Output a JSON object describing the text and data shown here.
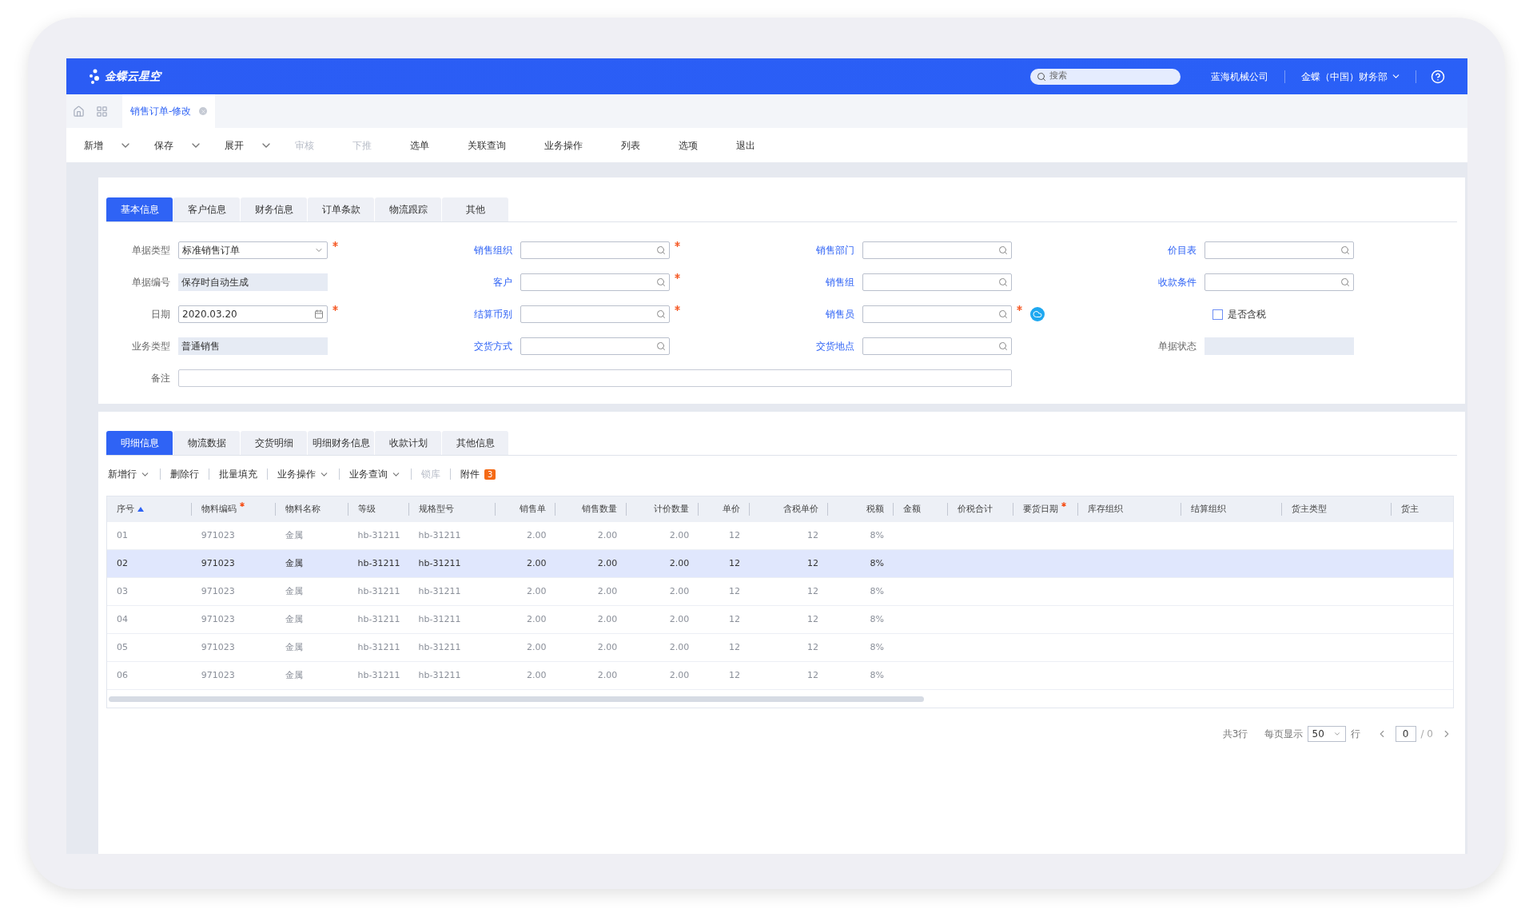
{
  "header": {
    "logo": "金蝶云星空",
    "search": {
      "placeholder": "搜索"
    },
    "company": "蓝海机械公司",
    "department": "金蝶（中国）财务部"
  },
  "page_tabs": [
    {
      "label": "销售订单-修改",
      "selected": true
    }
  ],
  "toolbar": [
    {
      "label": "新增",
      "kind": "split",
      "disabled": false
    },
    {
      "label": "保存",
      "kind": "split",
      "disabled": false
    },
    {
      "label": "展开",
      "kind": "split",
      "disabled": false
    },
    {
      "label": "审核",
      "kind": "plain",
      "disabled": true
    },
    {
      "label": "下推",
      "kind": "plain",
      "disabled": true
    },
    {
      "label": "选单",
      "kind": "plain",
      "disabled": false
    },
    {
      "label": "关联查询",
      "kind": "plain",
      "disabled": false
    },
    {
      "label": "业务操作",
      "kind": "plain",
      "disabled": false
    },
    {
      "label": "列表",
      "kind": "plain",
      "disabled": false
    },
    {
      "label": "选项",
      "kind": "plain",
      "disabled": false
    },
    {
      "label": "退出",
      "kind": "plain",
      "disabled": false
    }
  ],
  "form_tabs": [
    {
      "label": "基本信息",
      "selected": true
    },
    {
      "label": "客户信息",
      "selected": false
    },
    {
      "label": "财务信息",
      "selected": false
    },
    {
      "label": "订单条款",
      "selected": false
    },
    {
      "label": "物流跟踪",
      "selected": false
    },
    {
      "label": "其他",
      "selected": false
    }
  ],
  "form_fields": [
    {
      "label": "单据类型",
      "kind": "select",
      "value": "标准销售订单",
      "required": true,
      "link": false
    },
    {
      "label": "销售组织",
      "kind": "lookup",
      "required": true,
      "link": true
    },
    {
      "label": "销售部门",
      "kind": "lookup",
      "required": false,
      "link": true
    },
    {
      "label": "价目表",
      "kind": "lookup",
      "required": false,
      "link": true
    },
    {
      "label": "单据编号",
      "kind": "readonly",
      "value": "保存时自动生成",
      "required": false,
      "link": false
    },
    {
      "label": "客户",
      "kind": "lookup",
      "required": true,
      "link": true
    },
    {
      "label": "销售组",
      "kind": "lookup",
      "required": false,
      "link": true
    },
    {
      "label": "收款条件",
      "kind": "lookup",
      "required": false,
      "link": true
    },
    {
      "label": "日期",
      "kind": "date",
      "value": "2020.03.20",
      "required": true,
      "link": false
    },
    {
      "label": "结算币别",
      "kind": "lookup",
      "required": true,
      "link": true
    },
    {
      "label": "销售员",
      "kind": "lookup",
      "required": true,
      "link": true,
      "cloud": true
    },
    {
      "label": "是否含税",
      "kind": "checkbox",
      "checked": false
    },
    {
      "label": "业务类型",
      "kind": "readonly",
      "value": "普通销售",
      "required": false,
      "link": false
    },
    {
      "label": "交货方式",
      "kind": "lookup",
      "required": false,
      "link": true
    },
    {
      "label": "交货地点",
      "kind": "lookup",
      "required": false,
      "link": true
    },
    {
      "label": "单据状态",
      "kind": "readonly",
      "required": false,
      "link": false
    },
    {
      "label": "备注",
      "kind": "wide",
      "required": false,
      "link": false
    }
  ],
  "grid_tabs": [
    {
      "label": "明细信息",
      "selected": true
    },
    {
      "label": "物流数据",
      "selected": false
    },
    {
      "label": "交货明细",
      "selected": false
    },
    {
      "label": "明细财务信息",
      "selected": false
    },
    {
      "label": "收款计划",
      "selected": false
    },
    {
      "label": "其他信息",
      "selected": false
    }
  ],
  "grid_toolbar": [
    {
      "label": "新增行",
      "dropdown": true,
      "disabled": false
    },
    {
      "label": "删除行",
      "dropdown": false,
      "disabled": false
    },
    {
      "label": "批量填充",
      "dropdown": false,
      "disabled": false
    },
    {
      "label": "业务操作",
      "dropdown": true,
      "disabled": false
    },
    {
      "label": "业务查询",
      "dropdown": true,
      "disabled": false
    },
    {
      "label": "锁库",
      "dropdown": false,
      "disabled": true
    },
    {
      "label": "附件",
      "dropdown": false,
      "disabled": false,
      "badge": "3"
    }
  ],
  "table": {
    "columns": [
      {
        "label": "序号",
        "kind": "text",
        "sorted": true
      },
      {
        "label": "物料编码",
        "kind": "text",
        "required": true
      },
      {
        "label": "物料名称",
        "kind": "text"
      },
      {
        "label": "等级",
        "kind": "text"
      },
      {
        "label": "规格型号",
        "kind": "text"
      },
      {
        "label": "销售单",
        "kind": "number"
      },
      {
        "label": "销售数量",
        "kind": "number"
      },
      {
        "label": "计价数量",
        "kind": "number"
      },
      {
        "label": "单价",
        "kind": "number"
      },
      {
        "label": "含税单价",
        "kind": "number"
      },
      {
        "label": "税额",
        "kind": "number"
      },
      {
        "label": "金额",
        "kind": "text"
      },
      {
        "label": "价税合计",
        "kind": "text"
      },
      {
        "label": "要货日期",
        "kind": "text",
        "required": true
      },
      {
        "label": "库存组织",
        "kind": "text"
      },
      {
        "label": "结算组织",
        "kind": "text"
      },
      {
        "label": "货主类型",
        "kind": "text"
      },
      {
        "label": "货主",
        "kind": "text"
      }
    ],
    "rows": [
      {
        "selected": false,
        "cells": [
          "01",
          "971023",
          "金属",
          "hb-31211",
          "hb-31211",
          "2.00",
          "2.00",
          "2.00",
          "12",
          "12",
          "8%"
        ]
      },
      {
        "selected": true,
        "cells": [
          "02",
          "971023",
          "金属",
          "hb-31211",
          "hb-31211",
          "2.00",
          "2.00",
          "2.00",
          "12",
          "12",
          "8%"
        ]
      },
      {
        "selected": false,
        "cells": [
          "03",
          "971023",
          "金属",
          "hb-31211",
          "hb-31211",
          "2.00",
          "2.00",
          "2.00",
          "12",
          "12",
          "8%"
        ]
      },
      {
        "selected": false,
        "cells": [
          "04",
          "971023",
          "金属",
          "hb-31211",
          "hb-31211",
          "2.00",
          "2.00",
          "2.00",
          "12",
          "12",
          "8%"
        ]
      },
      {
        "selected": false,
        "cells": [
          "05",
          "971023",
          "金属",
          "hb-31211",
          "hb-31211",
          "2.00",
          "2.00",
          "2.00",
          "12",
          "12",
          "8%"
        ]
      },
      {
        "selected": false,
        "cells": [
          "06",
          "971023",
          "金属",
          "hb-31211",
          "hb-31211",
          "2.00",
          "2.00",
          "2.00",
          "12",
          "12",
          "8%"
        ]
      }
    ]
  },
  "pagination": {
    "total": "共3行",
    "per_page_label": "每页显示",
    "per_page": "50",
    "per_page_unit": "行",
    "page": "0",
    "page_total": "/ 0"
  }
}
